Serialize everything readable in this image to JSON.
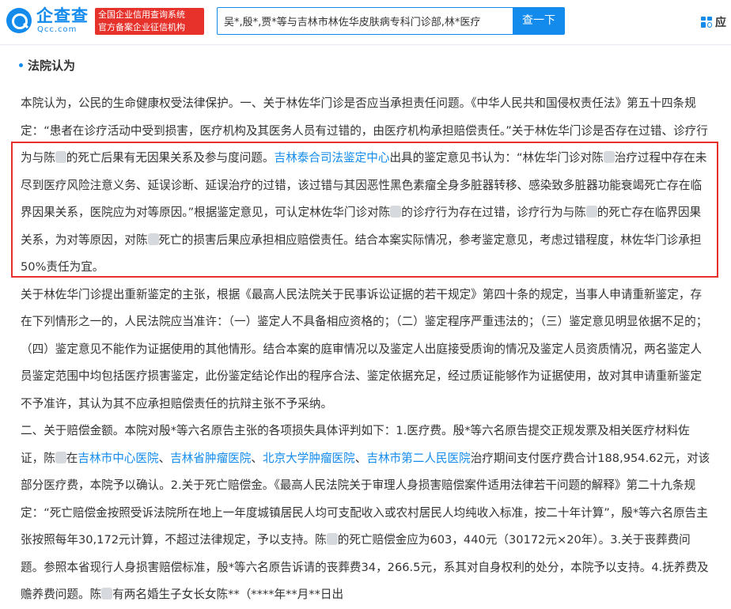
{
  "header": {
    "logo_text": "企查查",
    "logo_sub": "Qcc.com",
    "slogan_line1": "全国企业信用查询系统",
    "slogan_line2": "官方备案企业征信机构",
    "search_value": "吴*,殷*,贾*等与吉林市林佐华皮肤病专科门诊部,林*医疗",
    "search_button": "查一下",
    "app_label": "应"
  },
  "section": {
    "title": "法院认为"
  },
  "body": {
    "t01": "本院认为，公民的生命健康权受法律保护。一、关于林佐华门诊是否应当承担责任问题。《中华人民共和国侵权责任法》第五十四条规定：“患者在诊疗活动中受到损害，医疗机构及其医务人员有过错的，由医疗机构承担赔偿责任。”关于林佐华门诊是否存在过错、诊疗行为与陈",
    "t02": "的死亡后果有无因果关系及参与度问题。",
    "link1": "吉林泰合司法鉴定中心",
    "t03": "出具的鉴定意见书认为：“林佐华门诊对陈",
    "t04": "治疗过程中存在未尽到医疗风险注意义务、延误诊断、延误治疗的过错，该过错与其因恶性黑色素瘤全身多脏器转移、感染致多脏器功能衰竭死亡存在临界因果关系，医院应为对等原因。”根据鉴定意见，可认定林佐华门诊对陈",
    "t05": "的诊疗行为存在过错，诊疗行为与陈",
    "t06": "的死亡存在临界因果关系，为对等原因，对陈",
    "t07": "死亡的损害后果应承担相应赔偿责任。结合本案实际情况，参考鉴定意见，考虑过错程度，林佐华门诊承担50%责任为宜。",
    "t08": "关于林佐华门诊提出重新鉴定的主张，根据《最高人民法院关于民事诉讼证据的若干规定》第四十条的规定，当事人申请重新鉴定，存在下列情形之一的，人民法院应当准许：（一）鉴定人不具备相应资格的；（二）鉴定程序严重违法的；（三）鉴定意见明显依据不足的；（四）鉴定意见不能作为证据使用的其他情形。结合本案的庭审情况以及鉴定人出庭接受质询的情况及鉴定人员资质情况，两名鉴定人员鉴定范围中均包括医疗损害鉴定，此份鉴定结论作出的程序合法、鉴定依据充足，经过质证能够作为证据使用，故对其申请重新鉴定不予准许，其认为其不应承担赔偿责任的抗辩主张不予采纳。",
    "t09": "二、关于赔偿金额。本院对殷*等六名原告主张的各项损失具体评判如下：1.医疗费。殷*等六名原告提交正规发票及相关医疗材料佐证，陈",
    "t10": "在",
    "link2": "吉林市中心医院",
    "sep1": "、",
    "link3": "吉林省肿瘤医院",
    "sep2": "、",
    "link4": "北京大学肿瘤医院",
    "sep3": "、",
    "link5": "吉林市第二人民医院",
    "t11": "治疗期间支付医疗费合计188,954.62元，对该部分医疗费，本院予以确认。2.关于死亡赔偿金。《最高人民法院关于审理人身损害赔偿案件适用法律若干问题的解释》第二十九条规定：“死亡赔偿金按照受诉法院所在地上一年度城镇居民人均可支配收入或农村居民人均纯收入标准，按二十年计算”，殷*等六名原告主张按照每年30,172元计算，不超过法律规定，予以支持。陈",
    "t12": "的死亡赔偿金应为603，440元（30172元×20年）。3.关于丧葬费问题。参照本省现行人身损害赔偿标准，殷*等六名原告诉请的丧葬费34，266.5元，系其对自身权利的处分，本院予以支持。4.抚养费及赡养费问题。陈",
    "t13": "有两名婚生子女长女陈**（****年**月**日出"
  },
  "colors": {
    "brand": "#128bed",
    "slogan_bg": "#e7322c",
    "highlight_border": "#e8302b",
    "text": "#333333"
  }
}
